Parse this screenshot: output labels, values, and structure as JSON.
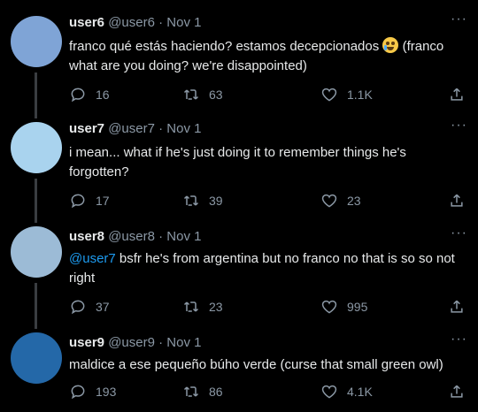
{
  "tweets": [
    {
      "name": "user6",
      "handle": "@user6",
      "sep": "·",
      "date": "Nov 1",
      "text": "franco qué estás haciendo? estamos decepcionados",
      "text2": " (franco what are you doing? we're disappointed)",
      "emoji": "crying-face",
      "replies": "16",
      "retweets": "63",
      "likes": "1.1K",
      "avatar_color": "#7fa4d6"
    },
    {
      "name": "user7",
      "handle": "@user7",
      "sep": "·",
      "date": "Nov 1",
      "text": "i mean... what if he's just doing it to remember things he's forgotten?",
      "replies": "17",
      "retweets": "39",
      "likes": "23",
      "avatar_color": "#a9d3ee"
    },
    {
      "name": "user8",
      "handle": "@user8",
      "sep": "·",
      "date": "Nov 1",
      "mention": "@user7",
      "text": " bsfr he's from argentina but no franco no that is so so not right",
      "replies": "37",
      "retweets": "23",
      "likes": "995",
      "avatar_color": "#9cbbd6"
    },
    {
      "name": "user9",
      "handle": "@user9",
      "sep": "·",
      "date": "Nov 1",
      "text": "maldice a ese pequeño búho verde (curse that small green owl)",
      "replies": "193",
      "retweets": "86",
      "likes": "4.1K",
      "avatar_color": "#2468a8"
    }
  ],
  "more_glyph": "···",
  "colors": {
    "background": "#000000",
    "text": "#e7e9ea",
    "muted": "#8b98a5",
    "link": "#1d9bf0"
  }
}
